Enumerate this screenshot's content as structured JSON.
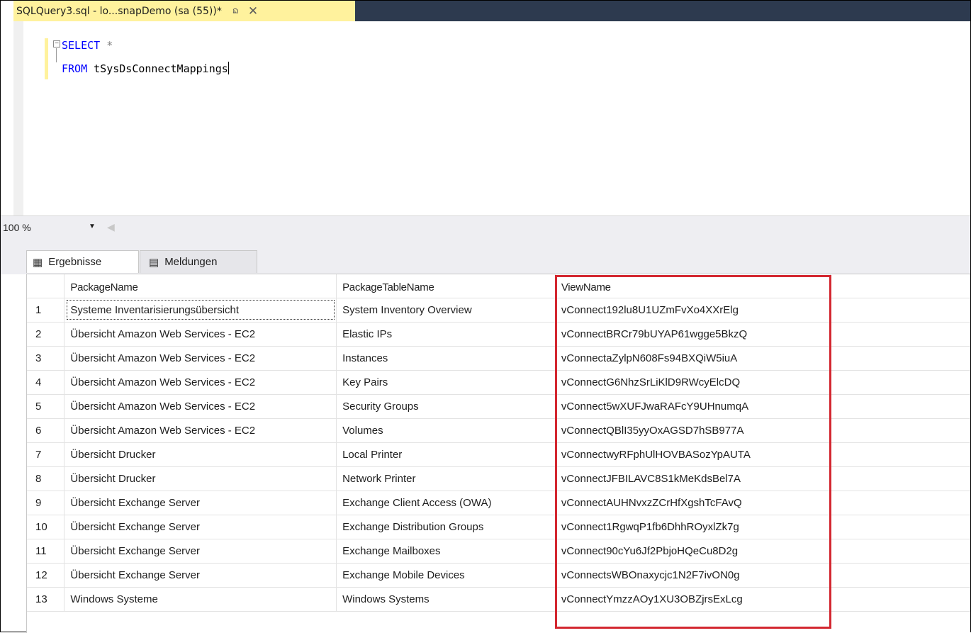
{
  "tab": {
    "title": "SQLQuery3.sql - lo...snapDemo (sa (55))*",
    "pin_glyph": "ᨦ",
    "close_glyph": "✕"
  },
  "editor": {
    "line1_kw": "SELECT",
    "line1_op": " *",
    "line2_kw": "FROM",
    "line2_table": " tSysDsConnectMappings"
  },
  "zoom": {
    "value": "100 %"
  },
  "result_tabs": {
    "results_label": "Ergebnisse",
    "messages_label": "Meldungen"
  },
  "grid": {
    "columns": [
      "PackageName",
      "PackageTableName",
      "ViewName"
    ],
    "rows": [
      [
        "1",
        "Systeme Inventarisierungsübersicht",
        "System Inventory Overview",
        "vConnect192lu8U1UZmFvXo4XXrElg"
      ],
      [
        "2",
        "Übersicht Amazon Web Services - EC2",
        "Elastic IPs",
        "vConnectBRCr79bUYAP61wgge5BkzQ"
      ],
      [
        "3",
        "Übersicht Amazon Web Services - EC2",
        "Instances",
        "vConnectaZylpN608Fs94BXQiW5iuA"
      ],
      [
        "4",
        "Übersicht Amazon Web Services - EC2",
        "Key Pairs",
        "vConnectG6NhzSrLiKlD9RWcyElcDQ"
      ],
      [
        "5",
        "Übersicht Amazon Web Services - EC2",
        "Security Groups",
        "vConnect5wXUFJwaRAFcY9UHnumqA"
      ],
      [
        "6",
        "Übersicht Amazon Web Services - EC2",
        "Volumes",
        "vConnectQBlI35yyOxAGSD7hSB977A"
      ],
      [
        "7",
        "Übersicht Drucker",
        "Local Printer",
        "vConnectwyRFphUlHOVBASozYpAUTA"
      ],
      [
        "8",
        "Übersicht Drucker",
        "Network Printer",
        "vConnectJFBILAVC8S1kMeKdsBel7A"
      ],
      [
        "9",
        "Übersicht Exchange Server",
        "Exchange Client Access (OWA)",
        "vConnectAUHNvxzZCrHfXgshTcFAvQ"
      ],
      [
        "10",
        "Übersicht Exchange Server",
        "Exchange Distribution Groups",
        "vConnect1RgwqP1fb6DhhROyxlZk7g"
      ],
      [
        "11",
        "Übersicht Exchange Server",
        "Exchange Mailboxes",
        "vConnect90cYu6Jf2PbjoHQeCu8D2g"
      ],
      [
        "12",
        "Übersicht Exchange Server",
        "Exchange Mobile Devices",
        "vConnectsWBOnaxycjc1N2F7ivON0g"
      ],
      [
        "13",
        "Windows Systeme",
        "Windows Systems",
        "vConnectYmzzAOy1XU3OBZjrsExLcg"
      ]
    ]
  },
  "colors": {
    "active_tab": "#fff29d",
    "tab_strip": "#2d3a4f",
    "keyword": "#0000ff",
    "highlight_border": "#d32730"
  }
}
